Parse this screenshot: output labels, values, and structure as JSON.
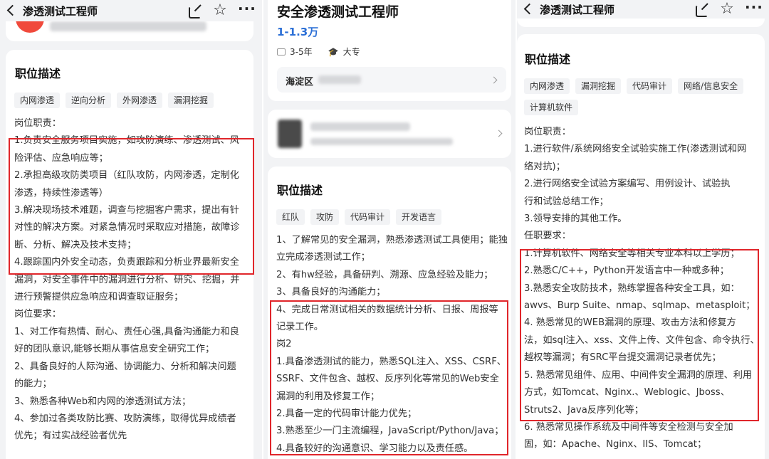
{
  "left": {
    "header_title": "渗透测试工程师",
    "section_title": "职位描述",
    "tags": [
      "内网渗透",
      "逆向分析",
      "外网渗透",
      "漏洞挖掘"
    ],
    "lines": [
      "岗位职责：",
      "1.负责安全服务项目实施，如攻防演练、渗透测试、风",
      "险评估、应急响应等；",
      "2.承担高级攻防类项目（红队攻防，内网渗透，定制化",
      "渗透，持续性渗透等）",
      "3.解决现场技术难题，调查与挖掘客户需求，提出有针",
      "对性的解决方案。对紧急情况时采取应对措施，故障诊",
      "断、分析、解决及技术支持；",
      "4.跟踪国内外安全动态，负责跟踪和分析业界最新安全",
      "漏洞，对安全事件中的漏洞进行分析、研究、挖掘，并",
      "进行预警提供应急响应和调查取证服务；",
      "岗位要求：",
      "1、对工作有热情、耐心、责任心强,具备沟通能力和良",
      "好的团队意识,能够长期从事信息安全研究工作；",
      "2、具备良好的人际沟通、协调能力、分析和解决问题",
      "的能力；",
      "3、熟悉各种Web和内网的渗透测试方法；",
      "4、参加过各类攻防比赛、攻防演练，取得优异成绩者",
      "优先；有过实战经验者优先"
    ]
  },
  "middle": {
    "job_title": "安全渗透测试工程师",
    "salary": "1-1.3万",
    "experience": "3-5年",
    "education": "大专",
    "location": "海淀区",
    "section_title": "职位描述",
    "tags": [
      "红队",
      "攻防",
      "代码审计",
      "开发语言"
    ],
    "lines": [
      "1、了解常见的安全漏洞，熟悉渗透测试工具使用；能独",
      "立完成渗透测试工作；",
      "2、有hw经验，具备研判、溯源、应急经验及能力；",
      "3、具备良好的沟通能力；",
      "4、完成日常测试相关的数据统计分析、日报、周报等",
      "记录工作。",
      "岗2",
      "1.具备渗透测试的能力，熟悉SQL注入、XSS、CSRF、",
      "SSRF、文件包含、越权、反序列化等常见的Web安全",
      "漏洞的利用及修复工作；",
      "2.具备一定的代码审计能力优先；",
      "3.熟悉至少一门主流编程，JavaScript/Python/Java；",
      "4.具备较好的沟通意识、学习能力以及责任感。"
    ]
  },
  "right": {
    "header_title": "渗透测试工程师",
    "section_title": "职位描述",
    "tags": [
      "内网渗透",
      "漏洞挖掘",
      "代码审计",
      "网络/信息安全",
      "计算机软件"
    ],
    "lines": [
      "岗位职责：",
      "1.进行软件/系统网络安全试验实施工作(渗透测试和网",
      "络对抗)；",
      "2.进行网络安全试验方案编写、用例设计、试验执",
      "行和试验总结工作；",
      "3.领导安排的其他工作。",
      "任职要求：",
      "1.计算机软件、网络安全等相关专业本科以上学历；",
      "2.熟悉C/C++，Python开发语言中一种或多种；",
      "3.熟悉安全攻防技术，熟练掌握各种安全工具，如：",
      "awvs、Burp Suite、nmap、sqlmap、metasploit；",
      "4. 熟悉常见的WEB漏洞的原理、攻击方法和修复方",
      "法，如sql注入、xss、文件上传、文件包含、命令执行、",
      "越权等漏洞；有SRC平台提交漏洞记录者优先；",
      "5. 熟悉常见组件、应用、中间件安全漏洞的原理、利用",
      "方式，如Tomcat、Nginx.、Weblogic、Jboss、",
      "Struts2、Java反序列化等；",
      "6. 熟悉常见操作系统及中间件等安全检测与安全加",
      "固，如：Apache、Nginx、IIS、Tomcat；"
    ]
  },
  "colors": {
    "highlight_box": "#e0262b",
    "salary": "#2b6fd6",
    "background": "#f2f3f5"
  },
  "icons": {
    "back": "chevron-left-icon",
    "share": "share-icon",
    "favorite": "star-icon",
    "more": "more-icon"
  }
}
